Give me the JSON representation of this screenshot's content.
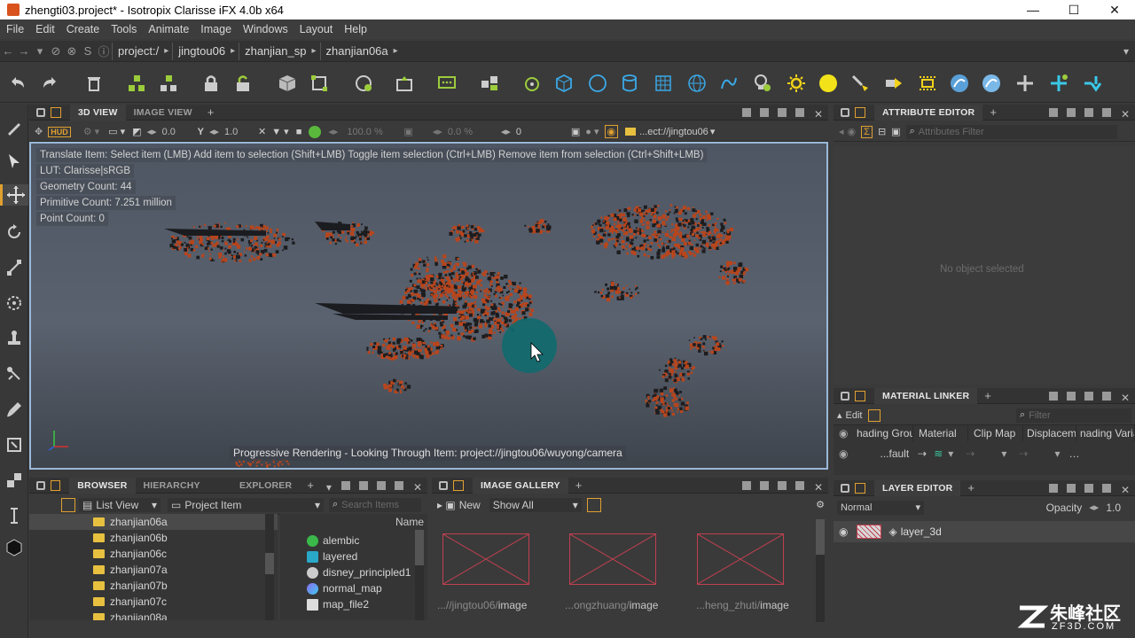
{
  "window": {
    "title": "zhengti03.project* - Isotropix Clarisse iFX 4.0b x64",
    "minimize": "—",
    "maximize": "☐",
    "close": "✕"
  },
  "menu": [
    "File",
    "Edit",
    "Create",
    "Tools",
    "Animate",
    "Image",
    "Windows",
    "Layout",
    "Help"
  ],
  "path": {
    "crumbs": [
      "project:/",
      "jingtou06",
      "zhanjian_sp",
      "zhanjian06a"
    ]
  },
  "viewport_panel": {
    "tabs": [
      "3D VIEW",
      "IMAGE VIEW"
    ],
    "toolbar": {
      "hud": "HUD",
      "value1": "0.0",
      "value2": "1.0",
      "zoom": "100.0 %",
      "exposure": "0.0 %",
      "frame": "0",
      "camera": "...ect://jingtou06"
    },
    "hud_lines": [
      "Translate Item: Select item (LMB)  Add item to selection (Shift+LMB)  Toggle item selection (Ctrl+LMB)  Remove item from selection (Ctrl+Shift+LMB)",
      "LUT: Clarisse|sRGB",
      "Geometry Count: 44",
      "Primitive Count: 7.251 million",
      "Point Count: 0"
    ],
    "status": "Progressive Rendering - Looking Through Item: project://jingtou06/wuyong/camera"
  },
  "attribute_editor": {
    "title": "ATTRIBUTE EDITOR",
    "filter_placeholder": "Attributes Filter",
    "empty_text": "No object selected"
  },
  "material_linker": {
    "title": "MATERIAL LINKER",
    "edit_label": "Edit",
    "filter_placeholder": "Filter",
    "columns": [
      "hading Grou",
      "Material",
      "Clip Map",
      "Displaceme",
      "nading Varia"
    ],
    "row_value": "...fault"
  },
  "layer_editor": {
    "title": "LAYER EDITOR",
    "blend_mode": "Normal",
    "opacity_label": "Opacity",
    "opacity_value": "1.0",
    "layer_name": "layer_3d"
  },
  "browser": {
    "tabs": [
      "BROWSER",
      "HIERARCHY VIEW",
      "EXPLORER"
    ],
    "view_mode": "List View",
    "context": "Project Item",
    "search_placeholder": "Search Items",
    "name_header": "Name",
    "folders": [
      "zhanjian06a",
      "zhanjian06b",
      "zhanjian06c",
      "zhanjian07a",
      "zhanjian07b",
      "zhanjian07c",
      "zhanjian08a"
    ],
    "items": [
      "alembic",
      "layered",
      "disney_principled1",
      "normal_map",
      "map_file2"
    ]
  },
  "image_gallery": {
    "title": "IMAGE GALLERY",
    "new_label": "New",
    "filter": "Show All",
    "thumbs": [
      {
        "prefix": "...//jingtou06/",
        "suffix": "image"
      },
      {
        "prefix": "...ongzhuang/",
        "suffix": "image"
      },
      {
        "prefix": "...heng_zhuti/",
        "suffix": "image"
      }
    ]
  },
  "watermark": {
    "text": "朱峰社区",
    "url": "ZF3D.COM"
  },
  "colors": {
    "accent": "#e0a030",
    "viewport_border": "#9ab8d8",
    "debris": "#b8451c",
    "cursor_highlight": "#0f6a6e"
  }
}
